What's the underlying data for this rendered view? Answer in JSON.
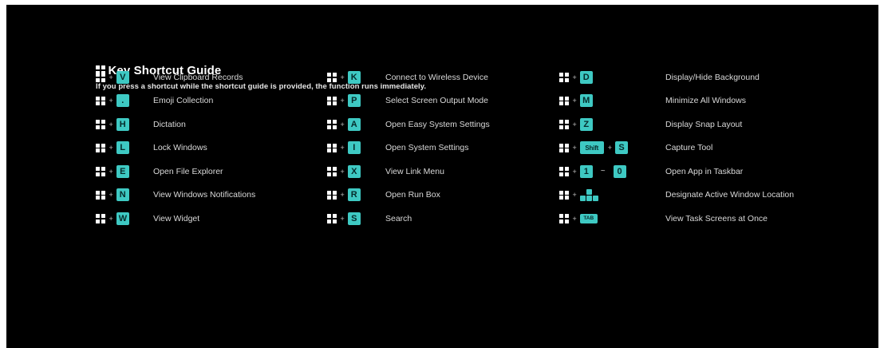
{
  "guide": {
    "title": "Key Shortcut Guide",
    "subtitle": "If you press a shortcut while the shortcut guide is provided, the function runs immediately."
  },
  "columns": [
    {
      "rows": [
        {
          "key": "V",
          "label": "View Clipboard Records"
        },
        {
          "key": ".",
          "label": "Emoji Collection"
        },
        {
          "key": "H",
          "label": "Dictation"
        },
        {
          "key": "L",
          "label": "Lock Windows"
        },
        {
          "key": "E",
          "label": "Open File Explorer"
        },
        {
          "key": "N",
          "label": "View Windows Notifications"
        },
        {
          "key": "W",
          "label": "View Widget"
        }
      ]
    },
    {
      "rows": [
        {
          "key": "K",
          "label": "Connect to Wireless Device"
        },
        {
          "key": "P",
          "label": "Select Screen Output Mode"
        },
        {
          "key": "A",
          "label": "Open Easy System Settings"
        },
        {
          "key": "I",
          "label": "Open System Settings"
        },
        {
          "key": "X",
          "label": "View Link Menu"
        },
        {
          "key": "R",
          "label": "Open Run Box"
        },
        {
          "key": "S",
          "label": "Search"
        }
      ]
    },
    {
      "rows": [
        {
          "key": "D",
          "label": "Display/Hide Background"
        },
        {
          "key": "M",
          "label": "Minimize All Windows"
        },
        {
          "key": "Z",
          "label": "Display Snap Layout"
        },
        {
          "key": "Shift",
          "key2": "S",
          "label": "Capture Tool"
        },
        {
          "key": "1",
          "tilde": "~",
          "key2": "0",
          "label": "Open App in Taskbar"
        },
        {
          "key": "arrow-keys",
          "label": "Designate Active Window Location"
        },
        {
          "key": "TAB",
          "label": "View Task Screens at Once"
        }
      ]
    }
  ],
  "symbols": {
    "plus": "+"
  },
  "colors": {
    "background": "#000000",
    "key_accent": "#3ec9c3",
    "text": "#d9d9d9"
  }
}
